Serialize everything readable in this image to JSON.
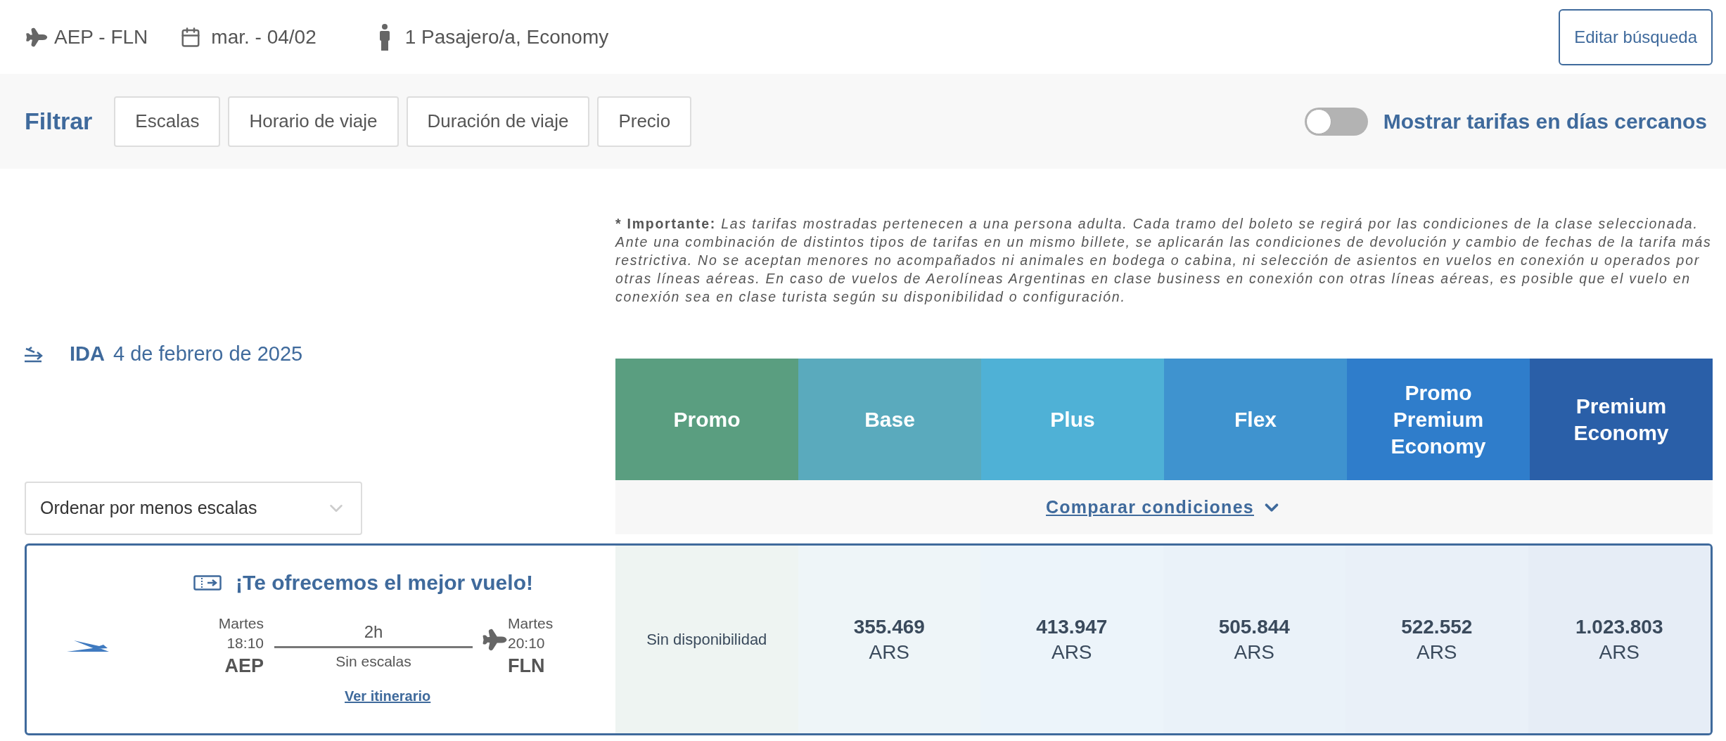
{
  "search_summary": {
    "route": "AEP - FLN",
    "date": "mar. - 04/02",
    "passengers": "1 Pasajero/a, Economy",
    "edit_button": "Editar búsqueda"
  },
  "filters": {
    "label": "Filtrar",
    "buttons": [
      "Escalas",
      "Horario de viaje",
      "Duración de viaje",
      "Precio"
    ],
    "toggle": {
      "label": "Mostrar tarifas en días cercanos",
      "on": false
    }
  },
  "notice": {
    "label": "* Importante:",
    "text": "Las tarifas mostradas pertenecen a una persona adulta. Cada tramo del boleto se regirá por las condiciones de la clase seleccionada. Ante una combinación de distintos tipos de tarifas en un mismo billete, se aplicarán las condiciones de devolución y cambio de fechas de la tarifa más restrictiva. No se aceptan menores no acompañados ni animales en bodega o cabina, ni selección de asientos en vuelos en conexión u operados por otras líneas aéreas. En caso de vuelos de Aerolíneas Argentinas en clase business en conexión con otras líneas aéreas, es posible que el vuelo en conexión sea en clase turista según su disponibilidad o configuración."
  },
  "journey": {
    "label": "IDA",
    "date": "4 de febrero de 2025"
  },
  "sort": {
    "value": "Ordenar por menos escalas"
  },
  "fares": [
    {
      "name": "Promo",
      "color": "#5a9e80"
    },
    {
      "name": "Base",
      "color": "#5aaabd"
    },
    {
      "name": "Plus",
      "color": "#4fb1d6"
    },
    {
      "name": "Flex",
      "color": "#3f93cf"
    },
    {
      "name": "Promo Premium Economy",
      "color": "#2f7dcb"
    },
    {
      "name": "Premium Economy",
      "color": "#2a5fa8"
    }
  ],
  "compare_link": "Comparar condiciones",
  "flight": {
    "banner": "¡Te ofrecemos el mejor vuelo!",
    "depart": {
      "day": "Martes",
      "time": "18:10",
      "code": "AEP"
    },
    "arrive": {
      "day": "Martes",
      "time": "20:10",
      "code": "FLN"
    },
    "duration": "2h",
    "stops": "Sin escalas",
    "link": "Ver itinerario",
    "prices": [
      {
        "kind": "unavailable",
        "text": "Sin disponibilidad"
      },
      {
        "kind": "price",
        "amount": "355.469",
        "currency": "ARS"
      },
      {
        "kind": "price",
        "amount": "413.947",
        "currency": "ARS"
      },
      {
        "kind": "price",
        "amount": "505.844",
        "currency": "ARS"
      },
      {
        "kind": "price",
        "amount": "522.552",
        "currency": "ARS"
      },
      {
        "kind": "price",
        "amount": "1.023.803",
        "currency": "ARS"
      }
    ]
  }
}
